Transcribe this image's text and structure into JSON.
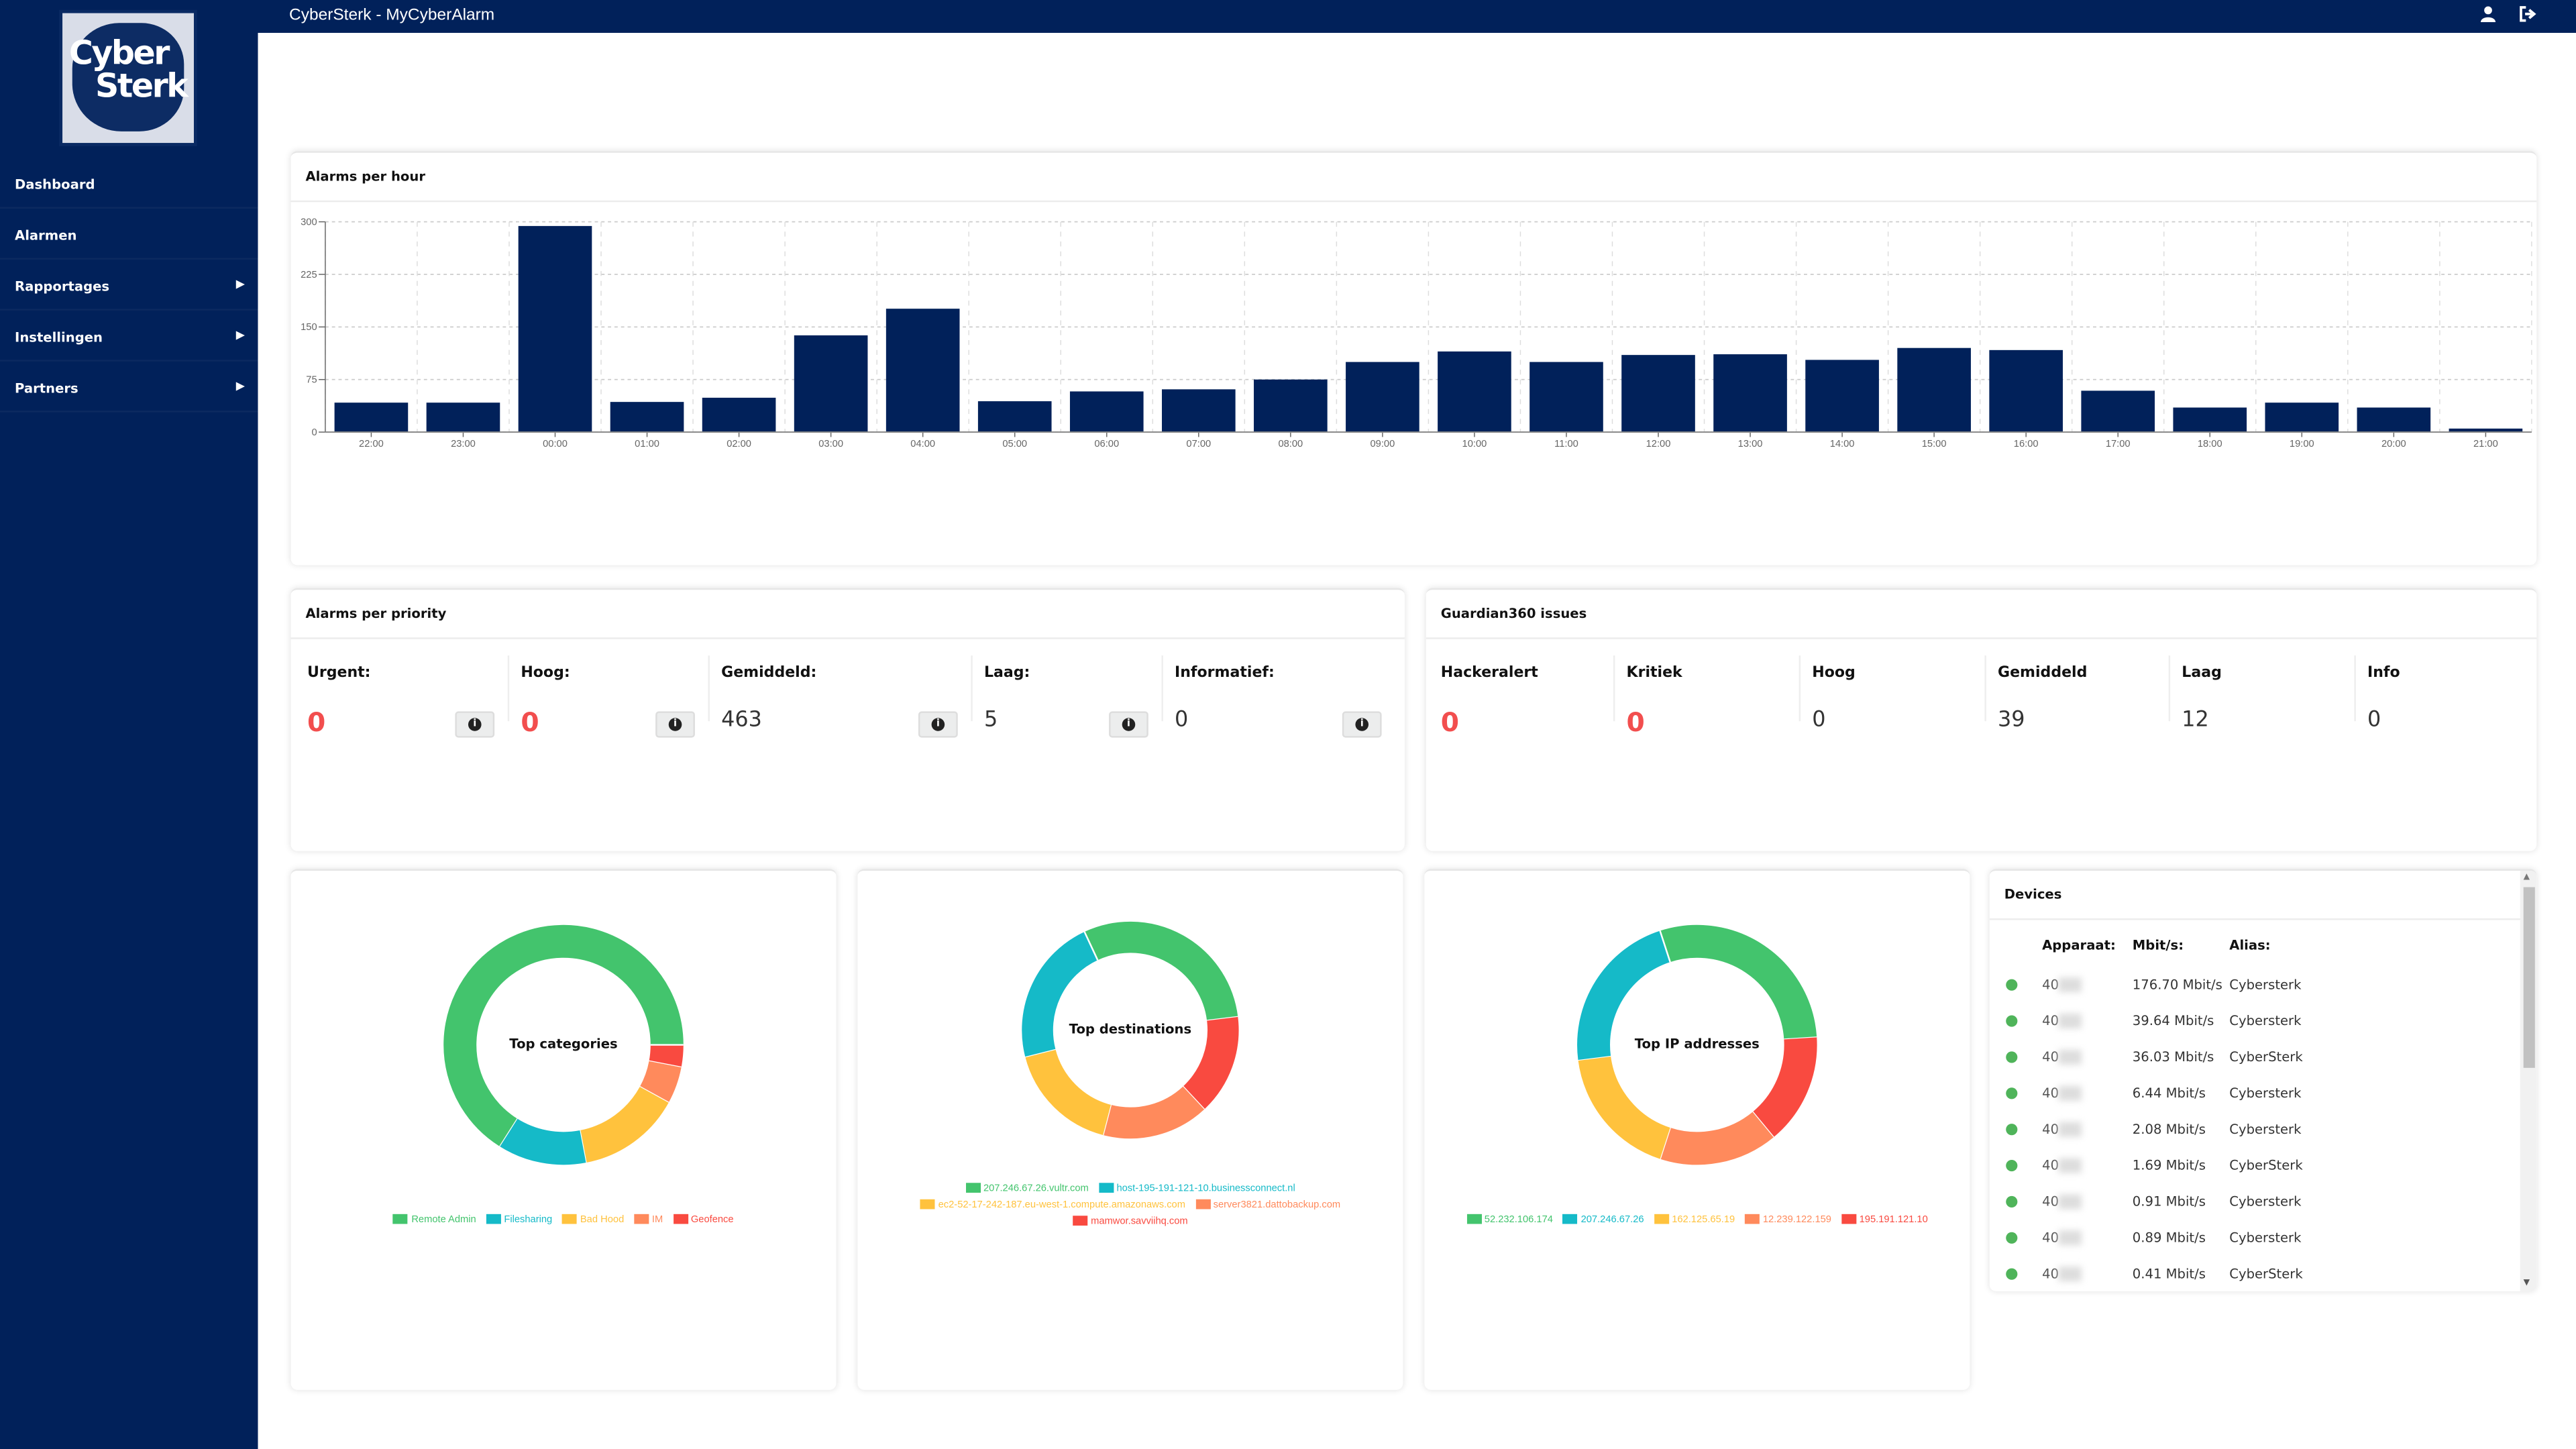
{
  "header": {
    "title": "CyberSterk - MyCyberAlarm",
    "icons": [
      "user-icon",
      "logout-icon"
    ]
  },
  "logo": {
    "text_line1": "Cyber",
    "text_line2": "Sterk"
  },
  "sidebar": {
    "items": [
      {
        "label": "Dashboard",
        "has_submenu": false
      },
      {
        "label": "Alarmen",
        "has_submenu": false
      },
      {
        "label": "Rapportages",
        "has_submenu": true
      },
      {
        "label": "Instellingen",
        "has_submenu": true
      },
      {
        "label": "Partners",
        "has_submenu": true
      }
    ]
  },
  "colors": {
    "brand": "#01215a",
    "bar": "#01215a",
    "alert": "#f24e4e",
    "green": "#43c46d",
    "teal": "#15bac8",
    "yellow": "#ffc23d",
    "orange": "#ff8a5c",
    "red": "#f94a40"
  },
  "alarms_per_hour": {
    "title": "Alarms per hour"
  },
  "chart_data": [
    {
      "type": "bar",
      "title": "Alarms per hour",
      "categories": [
        "22:00",
        "23:00",
        "00:00",
        "01:00",
        "02:00",
        "03:00",
        "04:00",
        "05:00",
        "06:00",
        "07:00",
        "08:00",
        "09:00",
        "10:00",
        "11:00",
        "12:00",
        "13:00",
        "14:00",
        "15:00",
        "16:00",
        "17:00",
        "18:00",
        "19:00",
        "20:00",
        "21:00"
      ],
      "values": [
        42,
        42,
        294,
        43,
        49,
        138,
        176,
        44,
        58,
        61,
        75,
        100,
        115,
        100,
        110,
        111,
        103,
        120,
        117,
        59,
        35,
        42,
        35,
        5
      ],
      "yticks": [
        0,
        75,
        150,
        225,
        300
      ],
      "ylim": [
        0,
        300
      ],
      "grid": true,
      "color": "#01215a"
    },
    {
      "type": "pie",
      "title": "Top categories",
      "labels": [
        "Remote Admin",
        "Filesharing",
        "Bad Hood",
        "IM",
        "Geofence"
      ],
      "values": [
        66,
        12,
        14,
        5,
        3
      ],
      "colors": [
        "#43c46d",
        "#15bac8",
        "#ffc23d",
        "#ff8a5c",
        "#f94a40"
      ],
      "legend": "bottom"
    },
    {
      "type": "pie",
      "title": "Top destinations",
      "labels": [
        "207.246.67.26.vultr.com",
        "host-195-191-121-10.businessconnect.nl",
        "ec2-52-17-242-187.eu-west-1.compute.amazonaws.com",
        "server3821.dattobackup.com",
        "mamwor.savviihq.com"
      ],
      "values": [
        30,
        22,
        17,
        16,
        15
      ],
      "colors": [
        "#43c46d",
        "#15bac8",
        "#ffc23d",
        "#ff8a5c",
        "#f94a40"
      ],
      "legend": "bottom"
    },
    {
      "type": "pie",
      "title": "Top IP addresses",
      "labels": [
        "52.232.106.174",
        "207.246.67.26",
        "162.125.65.19",
        "12.239.122.159",
        "195.191.121.10"
      ],
      "values": [
        29,
        22,
        18,
        16,
        15
      ],
      "colors": [
        "#43c46d",
        "#15bac8",
        "#ffc23d",
        "#ff8a5c",
        "#f94a40"
      ],
      "legend": "bottom"
    }
  ],
  "priority": {
    "title": "Alarms per priority",
    "items": [
      {
        "label": "Urgent:",
        "value": "0",
        "alert": true
      },
      {
        "label": "Hoog:",
        "value": "0",
        "alert": true
      },
      {
        "label": "Gemiddeld:",
        "value": "463",
        "alert": false
      },
      {
        "label": "Laag:",
        "value": "5",
        "alert": false
      },
      {
        "label": "Informatief:",
        "value": "0",
        "alert": false
      }
    ]
  },
  "guardian": {
    "title": "Guardian360 issues",
    "items": [
      {
        "label": "Hackeralert",
        "value": "0",
        "alert": true
      },
      {
        "label": "Kritiek",
        "value": "0",
        "alert": true
      },
      {
        "label": "Hoog",
        "value": "0",
        "alert": false
      },
      {
        "label": "Gemiddeld",
        "value": "39",
        "alert": false
      },
      {
        "label": "Laag",
        "value": "12",
        "alert": false
      },
      {
        "label": "Info",
        "value": "0",
        "alert": false
      }
    ]
  },
  "devices": {
    "title": "Devices",
    "columns": [
      "Apparaat:",
      "Mbit/s:",
      "Alias:"
    ],
    "rows": [
      {
        "id": "40",
        "mbit": "176.70 Mbit/s",
        "alias": "Cybersterk",
        "status": "online"
      },
      {
        "id": "40",
        "mbit": "39.64 Mbit/s",
        "alias": "Cybersterk",
        "status": "online"
      },
      {
        "id": "40",
        "mbit": "36.03 Mbit/s",
        "alias": "CyberSterk",
        "status": "online"
      },
      {
        "id": "40",
        "mbit": "6.44 Mbit/s",
        "alias": "Cybersterk",
        "status": "online"
      },
      {
        "id": "40",
        "mbit": "2.08 Mbit/s",
        "alias": "Cybersterk",
        "status": "online"
      },
      {
        "id": "40",
        "mbit": "1.69 Mbit/s",
        "alias": "CyberSterk",
        "status": "online"
      },
      {
        "id": "40",
        "mbit": "0.91 Mbit/s",
        "alias": "Cybersterk",
        "status": "online"
      },
      {
        "id": "40",
        "mbit": "0.89 Mbit/s",
        "alias": "Cybersterk",
        "status": "online"
      },
      {
        "id": "40",
        "mbit": "0.41 Mbit/s",
        "alias": "CyberSterk",
        "status": "online"
      }
    ]
  }
}
